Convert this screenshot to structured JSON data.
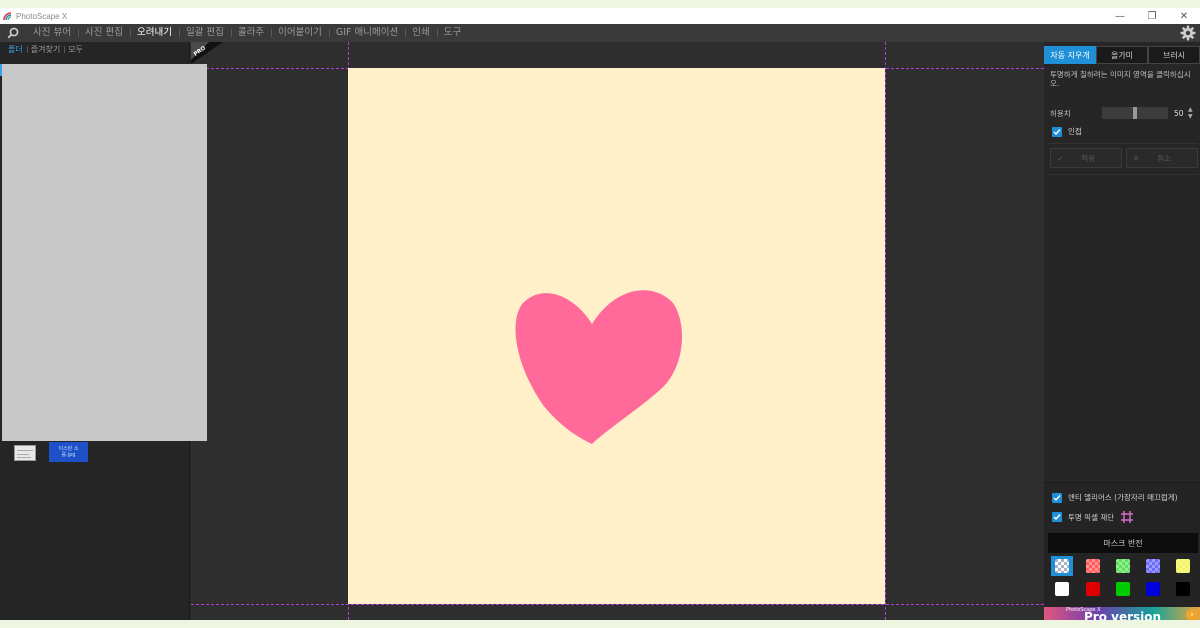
{
  "window": {
    "title": "PhotoScape X",
    "controls": {
      "minimize": "—",
      "maximize": "❐",
      "close": "✕"
    }
  },
  "menu": {
    "items": [
      {
        "label": "사진 뷰어"
      },
      {
        "label": "사진 편집"
      },
      {
        "label": "오려내기"
      },
      {
        "label": "일괄 편집"
      },
      {
        "label": "콜라주"
      },
      {
        "label": "이어붙이기"
      },
      {
        "label": "GIF 애니메이션"
      },
      {
        "label": "인쇄"
      },
      {
        "label": "도구"
      }
    ],
    "active": "오려내기"
  },
  "left_panel": {
    "tabs": [
      {
        "label": "폴더"
      },
      {
        "label": "즐겨찾기"
      },
      {
        "label": "모두"
      }
    ],
    "thumbnail_2": {
      "line1": "이스탄 소",
      "line2": "를.jpg"
    }
  },
  "canvas": {
    "badge": "PRO",
    "image_color": "#fff0c9",
    "heart_color": "#ff6a9a"
  },
  "right_panel": {
    "tabs": [
      {
        "label": "자동 지우개"
      },
      {
        "label": "올가미"
      },
      {
        "label": "브러시"
      }
    ],
    "hint": "투명하게 칠하려는 이미지 영역을 클릭하십시오.",
    "tolerance": {
      "label": "허용치",
      "value": "50",
      "fraction": 0.5
    },
    "adjacent": {
      "label": "인접",
      "checked": true
    },
    "apply_label": "적용",
    "cancel_label": "취소",
    "antialias": {
      "label": "앤티 앨리어스 (가장자리 매끄럽게)",
      "checked": true
    },
    "trim": {
      "label": "투명 픽셀 재단",
      "checked": true
    },
    "mask_invert_label": "마스크 반전",
    "swatches": [
      {
        "name": "transparent",
        "color": "checker"
      },
      {
        "name": "red-checker",
        "color": "#ff5d5d"
      },
      {
        "name": "green-checker",
        "color": "#5de05d"
      },
      {
        "name": "blue-checker",
        "color": "#6b6bff"
      },
      {
        "name": "yellow-checker",
        "color": "#f4f45d"
      },
      {
        "name": "white",
        "color": "#ffffff"
      },
      {
        "name": "red",
        "color": "#dd0000"
      },
      {
        "name": "green",
        "color": "#00cc00"
      },
      {
        "name": "blue",
        "color": "#0000dd"
      },
      {
        "name": "black",
        "color": "#000000"
      }
    ],
    "banner": {
      "small": "PhotoScape X",
      "big": "Pro version",
      "arrow": "›"
    }
  }
}
